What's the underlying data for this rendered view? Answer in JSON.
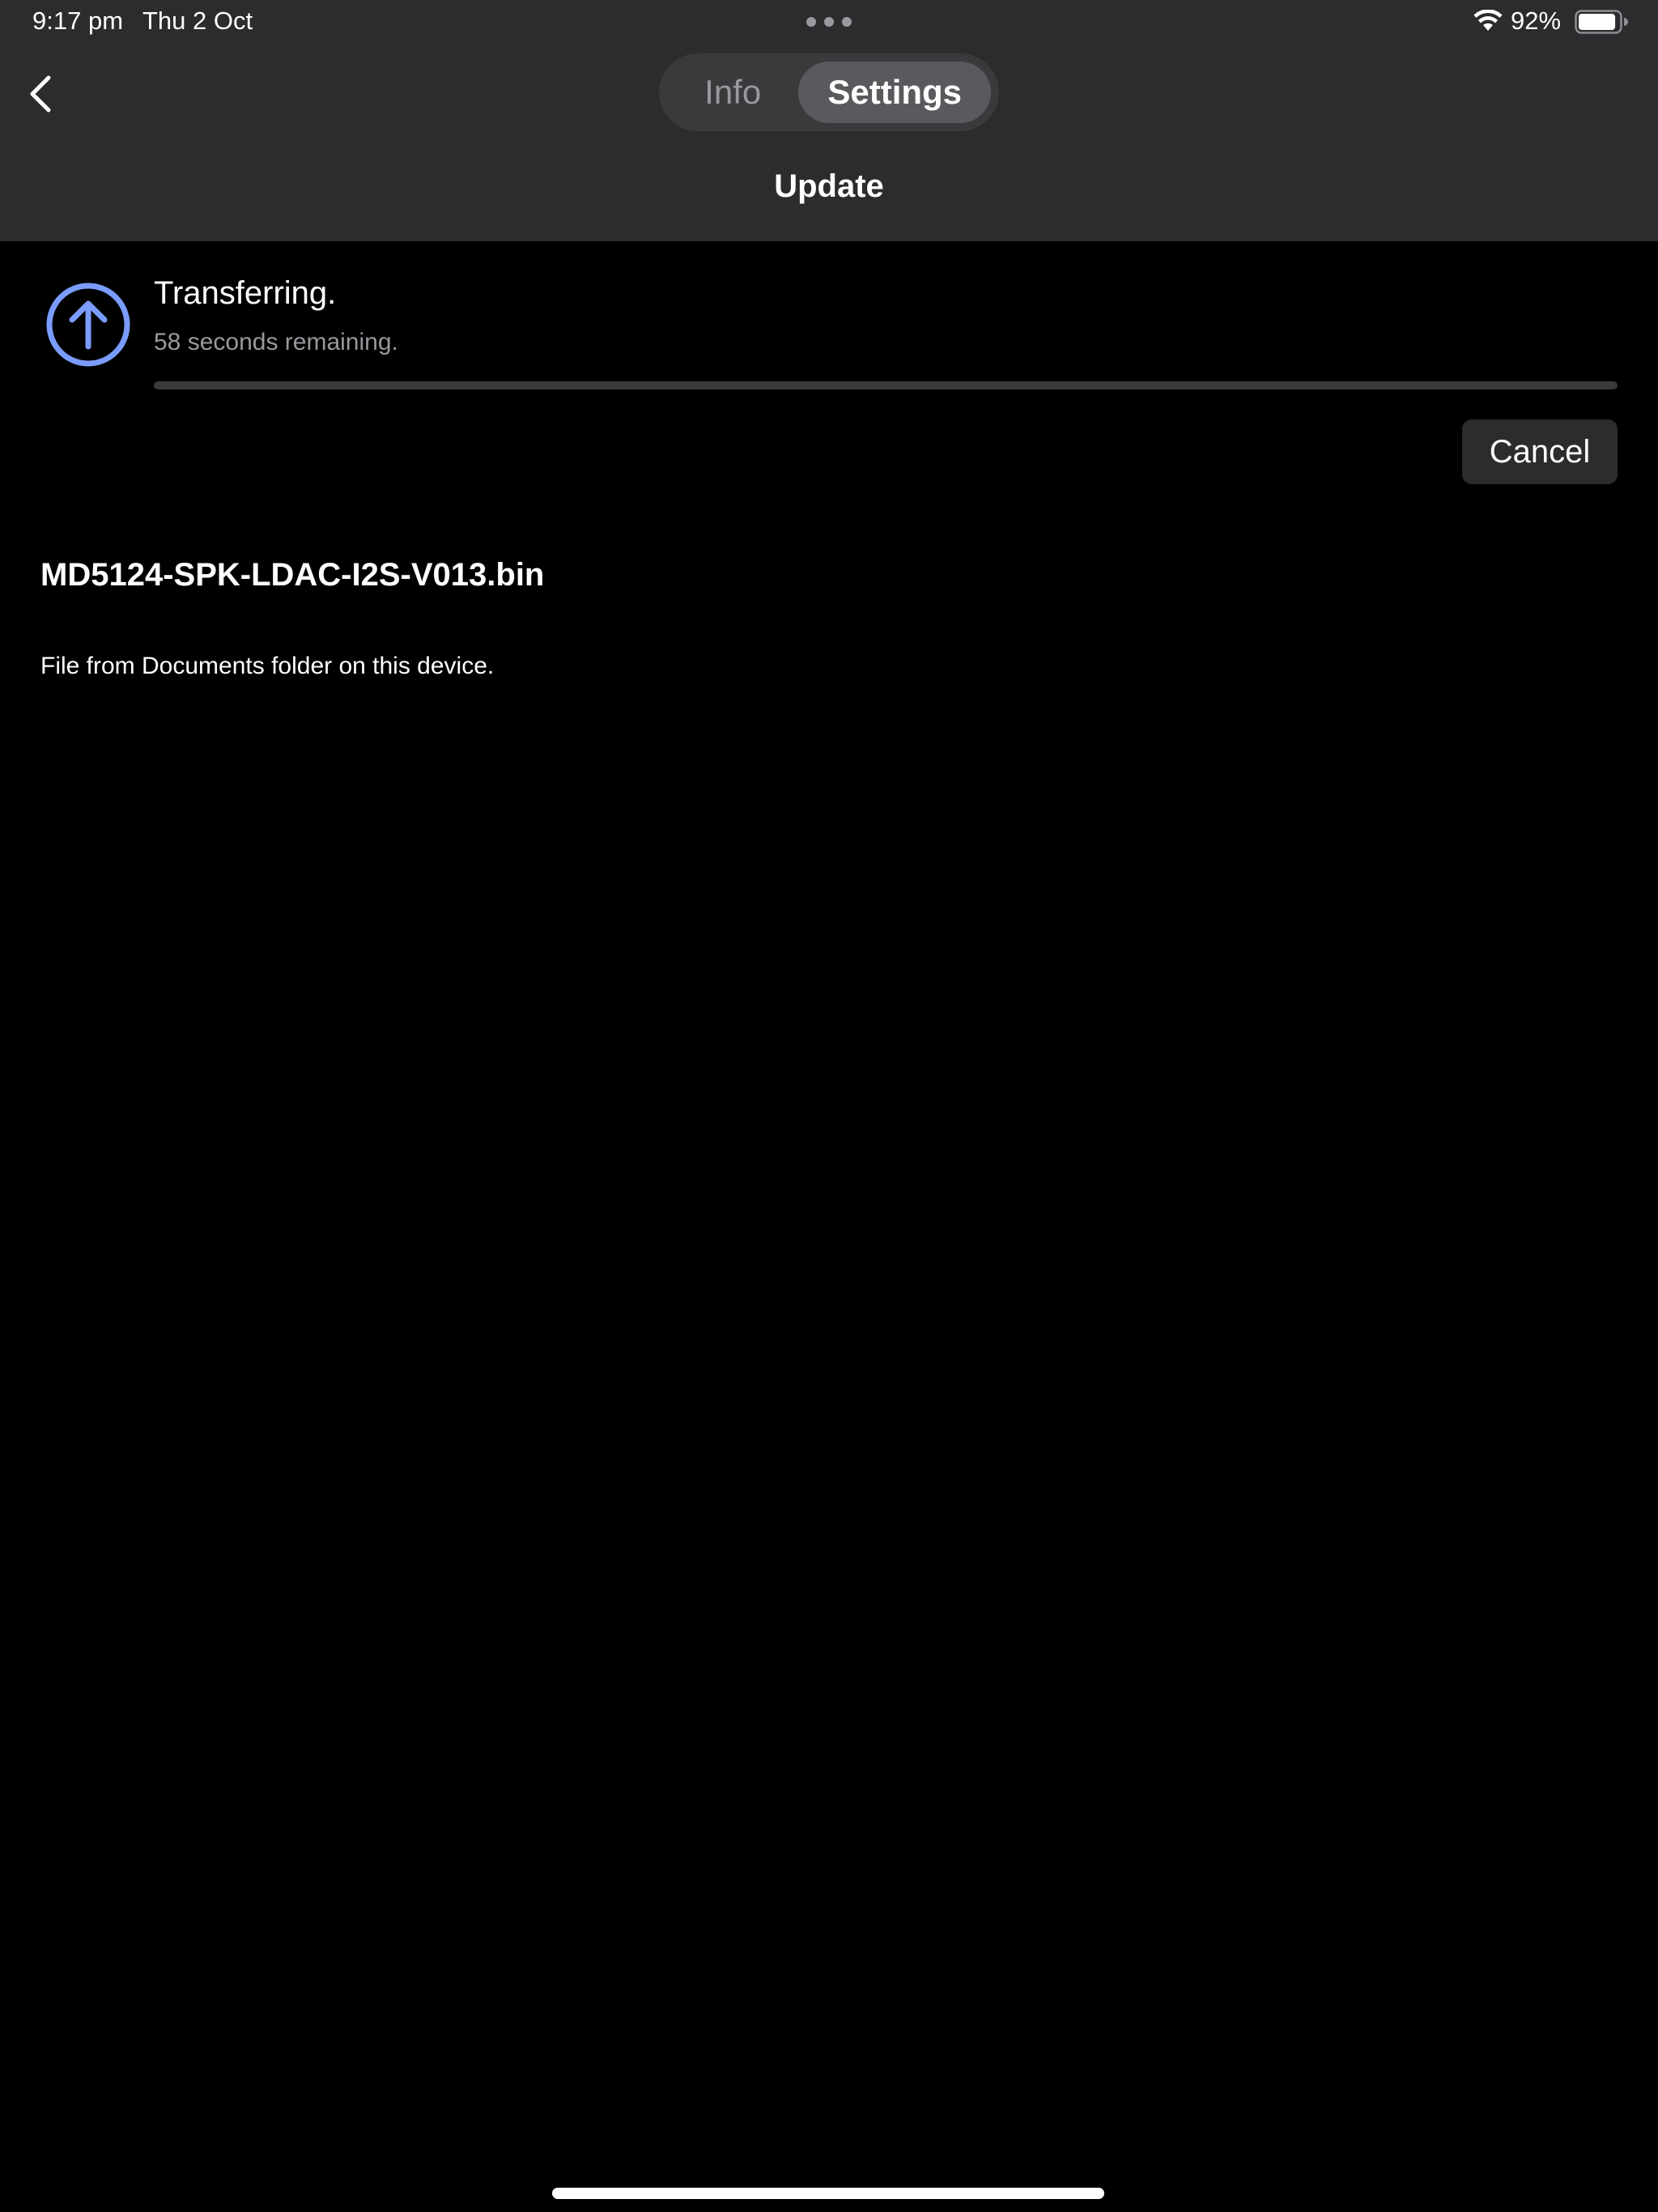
{
  "status_bar": {
    "time": "9:17 pm",
    "date": "Thu 2 Oct",
    "battery_percent": "92%",
    "battery_level": 0.92,
    "wifi_icon": "wifi-icon",
    "battery_icon": "battery-icon"
  },
  "nav": {
    "back_icon": "chevron-left-icon",
    "segments": [
      {
        "label": "Info",
        "selected": false
      },
      {
        "label": "Settings",
        "selected": true
      }
    ],
    "title": "Update"
  },
  "transfer": {
    "icon": "arrow-up-circle-icon",
    "status": "Transferring.",
    "remaining": "58 seconds remaining.",
    "progress": 0.0,
    "cancel_label": "Cancel"
  },
  "file": {
    "name": "MD5124-SPK-LDAC-I2S-V013.bin",
    "description": "File from Documents folder on this device."
  },
  "colors": {
    "header_bg": "#2c2c2e",
    "accent": "#7b9cff",
    "secondary_text": "#98989e",
    "progress_track": "#3a3a3c"
  }
}
